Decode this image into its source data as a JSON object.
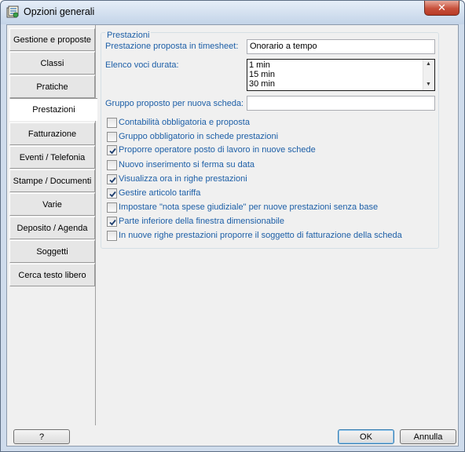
{
  "window": {
    "title": "Opzioni generali",
    "close_glyph": "✕"
  },
  "sidebar": {
    "items": [
      {
        "label": "Gestione e proposte"
      },
      {
        "label": "Classi"
      },
      {
        "label": "Pratiche"
      },
      {
        "label": "Prestazioni"
      },
      {
        "label": "Fatturazione"
      },
      {
        "label": "Eventi / Telefonia"
      },
      {
        "label": "Stampe / Documenti"
      },
      {
        "label": "Varie"
      },
      {
        "label": "Deposito / Agenda"
      },
      {
        "label": "Soggetti"
      },
      {
        "label": "Cerca testo libero"
      }
    ],
    "active_index": 3
  },
  "group": {
    "title": "Prestazioni",
    "proposed_label": "Prestazione proposta in timesheet:",
    "proposed_value": "Onorario a tempo",
    "durations_label": "Elenco voci durata:",
    "durations": [
      "1 min",
      "15 min",
      "30 min"
    ],
    "group_label": "Gruppo proposto per nuova scheda:",
    "group_value": ""
  },
  "checkboxes": [
    {
      "label": "Contabilità obbligatoria e proposta",
      "checked": false
    },
    {
      "label": "Gruppo obbligatorio in schede prestazioni",
      "checked": false
    },
    {
      "label": "Proporre operatore posto di lavoro in nuove schede",
      "checked": true
    },
    {
      "label": "Nuovo inserimento si ferma su data",
      "checked": false
    },
    {
      "label": "Visualizza ora in righe prestazioni",
      "checked": true
    },
    {
      "label": "Gestire articolo tariffa",
      "checked": true
    },
    {
      "label": "Impostare \"nota spese giudiziale\" per nuove prestazioni senza base",
      "checked": false
    },
    {
      "label": "Parte inferiore della finestra dimensionabile",
      "checked": true
    },
    {
      "label": "In nuove righe prestazioni proporre il soggetto di fatturazione della scheda",
      "checked": false
    }
  ],
  "buttons": {
    "help": "?",
    "ok": "OK",
    "cancel": "Annulla"
  },
  "icons": {
    "app": "settings-window-icon",
    "check": "check-icon"
  }
}
